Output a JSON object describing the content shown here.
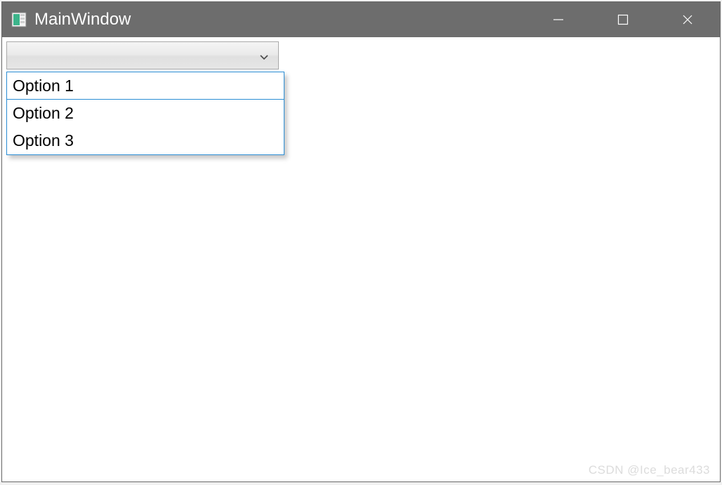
{
  "window": {
    "title": "MainWindow"
  },
  "combobox": {
    "selected": "",
    "options": [
      {
        "label": "Option 1",
        "highlighted": true
      },
      {
        "label": "Option 2",
        "highlighted": false
      },
      {
        "label": "Option 3",
        "highlighted": false
      }
    ]
  },
  "watermark": "CSDN @Ice_bear433"
}
